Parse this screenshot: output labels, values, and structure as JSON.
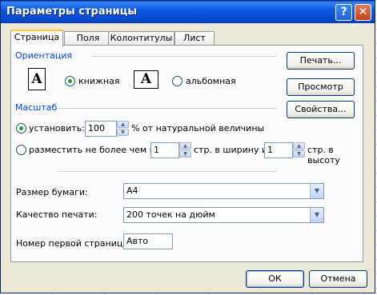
{
  "window": {
    "title": "Параметры страницы",
    "help_symbol": "?",
    "close_symbol": "✕"
  },
  "tabs": [
    {
      "label": "Страница",
      "active": true
    },
    {
      "label": "Поля"
    },
    {
      "label": "Колонтитулы"
    },
    {
      "label": "Лист"
    }
  ],
  "orientation": {
    "title": "Ориентация",
    "portrait_label": "книжная",
    "landscape_label": "альбомная",
    "selected": "portrait",
    "icon_glyph": "A"
  },
  "scale": {
    "title": "Масштаб",
    "set_label": "установить:",
    "set_value": "100",
    "set_suffix": "% от натуральной величины",
    "fit_label": "разместить не более чем на:",
    "fit_wide_value": "1",
    "fit_wide_suffix": "стр. в ширину и",
    "fit_tall_value": "1",
    "fit_tall_suffix": "стр. в высоту",
    "selected": "set"
  },
  "paper": {
    "size_label": "Размер бумаги:",
    "size_value": "A4",
    "quality_label": "Качество печати:",
    "quality_value": "200 точек на дюйм",
    "first_page_label": "Номер первой страницы:",
    "first_page_value": "Авто"
  },
  "side_buttons": {
    "print": "Печать...",
    "preview": "Просмотр",
    "properties": "Свойства..."
  },
  "footer": {
    "ok": "ОК",
    "cancel": "Отмена"
  },
  "colors": {
    "group_title": "#0046d5",
    "title_bar": "#0a5ae0",
    "dialog_bg": "#ece9d8"
  }
}
